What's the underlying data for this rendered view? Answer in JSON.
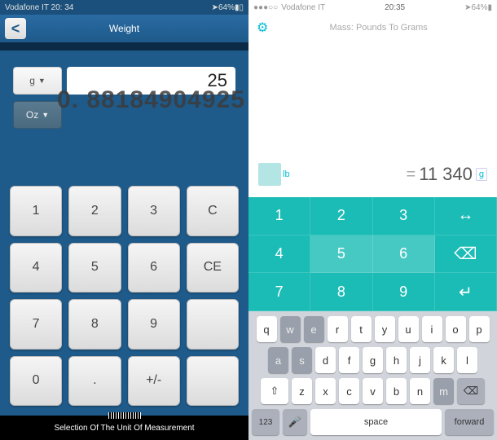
{
  "left": {
    "status": {
      "carrier": "Vodafone IT 20: 34",
      "battery": "64%"
    },
    "header": {
      "title": "Weight"
    },
    "back_icon": "<",
    "rows": {
      "input": {
        "unit": "g",
        "value": "25"
      },
      "output": {
        "unit": "Oz",
        "value": "0. 88184904925"
      }
    },
    "keypad": [
      "1",
      "2",
      "3",
      "C",
      "4",
      "5",
      "6",
      "CE",
      "7",
      "8",
      "9",
      "",
      "0",
      ".",
      "+/-",
      ""
    ],
    "footer": "Selection Of The Unit Of Measurement"
  },
  "right": {
    "status": {
      "carrier": "Vodafone IT",
      "time": "20:35",
      "battery": "64%"
    },
    "header": {
      "title": "Mass: Pounds To Grams"
    },
    "conversion": {
      "from_unit": "lb",
      "to_unit": "g",
      "equals": "=",
      "result": "11 340"
    },
    "tealpad": [
      "1",
      "2",
      "3",
      "↔",
      "4",
      "5",
      "6",
      "⌫",
      "7",
      "8",
      "9",
      "↵"
    ],
    "qwerty": {
      "row1": [
        "q",
        "w",
        "e",
        "r",
        "t",
        "y",
        "u",
        "i",
        "o",
        "p"
      ],
      "row2": [
        "a",
        "s",
        "d",
        "f",
        "g",
        "h",
        "j",
        "k",
        "l"
      ],
      "row3": [
        "z",
        "x",
        "c",
        "v",
        "b",
        "n",
        "m"
      ],
      "bottom": {
        "num": "123",
        "space": "Space",
        "forward": "Forward"
      }
    }
  }
}
